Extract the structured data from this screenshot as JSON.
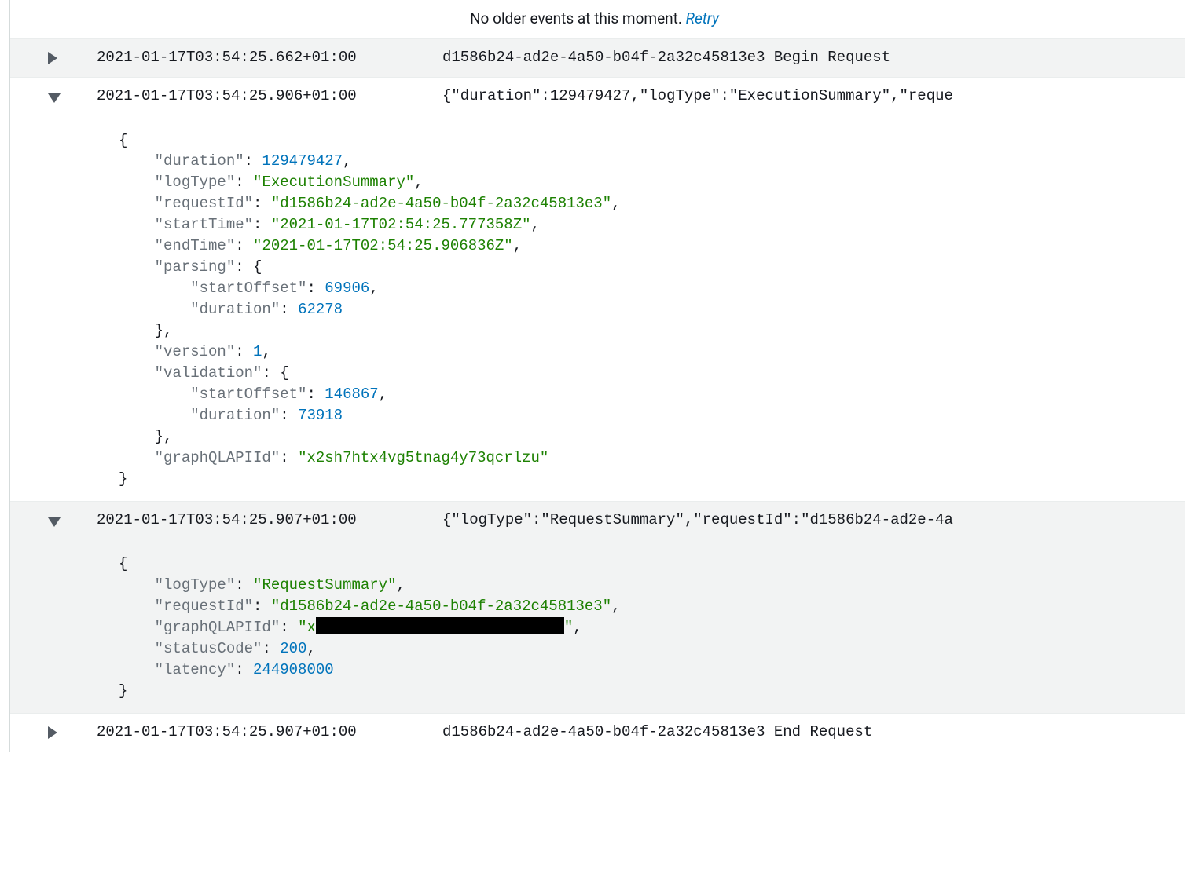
{
  "header": {
    "no_older": "No older events at this moment. ",
    "retry": "Retry"
  },
  "rows": [
    {
      "expanded": false,
      "alt": true,
      "timestamp": "2021-01-17T03:54:25.662+01:00",
      "message": "d1586b24-ad2e-4a50-b04f-2a32c45813e3 Begin Request"
    },
    {
      "expanded": true,
      "alt": false,
      "timestamp": "2021-01-17T03:54:25.906+01:00",
      "message": "{\"duration\":129479427,\"logType\":\"ExecutionSummary\",\"reque",
      "json": {
        "lines": [
          {
            "indent": 0,
            "type": "brace",
            "text": "{"
          },
          {
            "indent": 1,
            "key": "duration",
            "valType": "num",
            "val": "129479427",
            "comma": true
          },
          {
            "indent": 1,
            "key": "logType",
            "valType": "str",
            "val": "ExecutionSummary",
            "comma": true
          },
          {
            "indent": 1,
            "key": "requestId",
            "valType": "str",
            "val": "d1586b24-ad2e-4a50-b04f-2a32c45813e3",
            "comma": true
          },
          {
            "indent": 1,
            "key": "startTime",
            "valType": "str",
            "val": "2021-01-17T02:54:25.777358Z",
            "comma": true
          },
          {
            "indent": 1,
            "key": "endTime",
            "valType": "str",
            "val": "2021-01-17T02:54:25.906836Z",
            "comma": true
          },
          {
            "indent": 1,
            "key": "parsing",
            "valType": "open",
            "val": "{"
          },
          {
            "indent": 2,
            "key": "startOffset",
            "valType": "num",
            "val": "69906",
            "comma": true
          },
          {
            "indent": 2,
            "key": "duration",
            "valType": "num",
            "val": "62278"
          },
          {
            "indent": 1,
            "type": "brace",
            "text": "},",
            "closeComma": true
          },
          {
            "indent": 1,
            "key": "version",
            "valType": "num",
            "val": "1",
            "comma": true
          },
          {
            "indent": 1,
            "key": "validation",
            "valType": "open",
            "val": "{"
          },
          {
            "indent": 2,
            "key": "startOffset",
            "valType": "num",
            "val": "146867",
            "comma": true
          },
          {
            "indent": 2,
            "key": "duration",
            "valType": "num",
            "val": "73918"
          },
          {
            "indent": 1,
            "type": "brace",
            "text": "},",
            "closeComma": true
          },
          {
            "indent": 1,
            "key": "graphQLAPIId",
            "valType": "str",
            "val": "x2sh7htx4vg5tnag4y73qcrlzu"
          },
          {
            "indent": 0,
            "type": "brace",
            "text": "}"
          }
        ]
      }
    },
    {
      "expanded": true,
      "alt": true,
      "timestamp": "2021-01-17T03:54:25.907+01:00",
      "message": "{\"logType\":\"RequestSummary\",\"requestId\":\"d1586b24-ad2e-4a",
      "json": {
        "lines": [
          {
            "indent": 0,
            "type": "brace",
            "text": "{"
          },
          {
            "indent": 1,
            "key": "logType",
            "valType": "str",
            "val": "RequestSummary",
            "comma": true
          },
          {
            "indent": 1,
            "key": "requestId",
            "valType": "str",
            "val": "d1586b24-ad2e-4a50-b04f-2a32c45813e3",
            "comma": true
          },
          {
            "indent": 1,
            "key": "graphQLAPIId",
            "valType": "redact",
            "val": "x",
            "comma": true
          },
          {
            "indent": 1,
            "key": "statusCode",
            "valType": "num",
            "val": "200",
            "comma": true
          },
          {
            "indent": 1,
            "key": "latency",
            "valType": "num",
            "val": "244908000"
          },
          {
            "indent": 0,
            "type": "brace",
            "text": "}"
          }
        ]
      }
    },
    {
      "expanded": false,
      "alt": false,
      "timestamp": "2021-01-17T03:54:25.907+01:00",
      "message": "d1586b24-ad2e-4a50-b04f-2a32c45813e3 End Request"
    }
  ]
}
